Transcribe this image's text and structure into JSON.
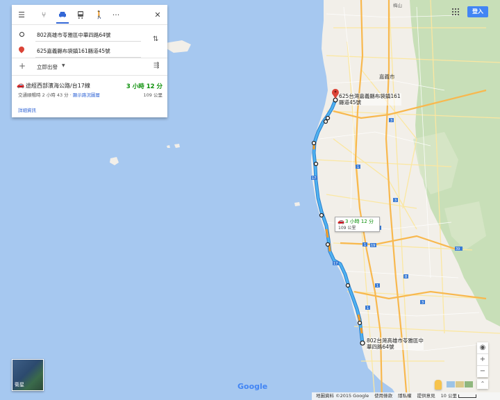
{
  "colors": {
    "sea": "#a6c8f0",
    "land": "#f2efe9",
    "forest": "#c8dfb8",
    "route": "#4a9fe0",
    "highway": "#f8b84e",
    "accent": "#4285f4"
  },
  "mode_bar": {
    "icons": [
      "menu-icon",
      "best-route-icon",
      "car-icon",
      "transit-icon",
      "walk-icon",
      "more-icon",
      "close-icon"
    ],
    "selected": "car"
  },
  "waypoints": {
    "origin": "802高雄市苓雅區中華四路64號",
    "destination": "625嘉義縣布袋鎮161縣道45號"
  },
  "options": {
    "add_icon": "+",
    "depart_label": "立即出發",
    "settings_icon": "⇶"
  },
  "route": {
    "via": "途經西部濱海公路/台17線",
    "time": "3 小時 12 分",
    "traffic_prefix": "交通順暢時 2 小時 43 分 · ",
    "traffic_link": "顯示路況圖層",
    "distance": "109 公里",
    "details_link": "詳細資訊"
  },
  "map_labels": {
    "chiayi_city": "嘉義市",
    "destination_callout": "625台灣嘉義縣布袋鎮161縣道45號",
    "origin_callout": "802台灣高雄市苓雅區中華四路64號",
    "route_box_time": "3 小時 12 分",
    "route_box_distance": "109 公里",
    "top_town": "梅山",
    "shields": [
      "17",
      "1",
      "3",
      "19",
      "1",
      "3",
      "10",
      "1",
      "3",
      "17",
      "8",
      "39",
      "1"
    ]
  },
  "top_right": {
    "signin_label": "登入"
  },
  "satellite_label": "衛星",
  "zoom": {
    "locate": "◉",
    "in": "+",
    "out": "−",
    "expand": "⌃"
  },
  "google_logo": "Google",
  "footer": {
    "attribution": "地圖資料 ©2015 Google",
    "terms": "使用條款",
    "privacy": "隱私權",
    "feedback": "提供意見",
    "scale": "10 公里"
  }
}
